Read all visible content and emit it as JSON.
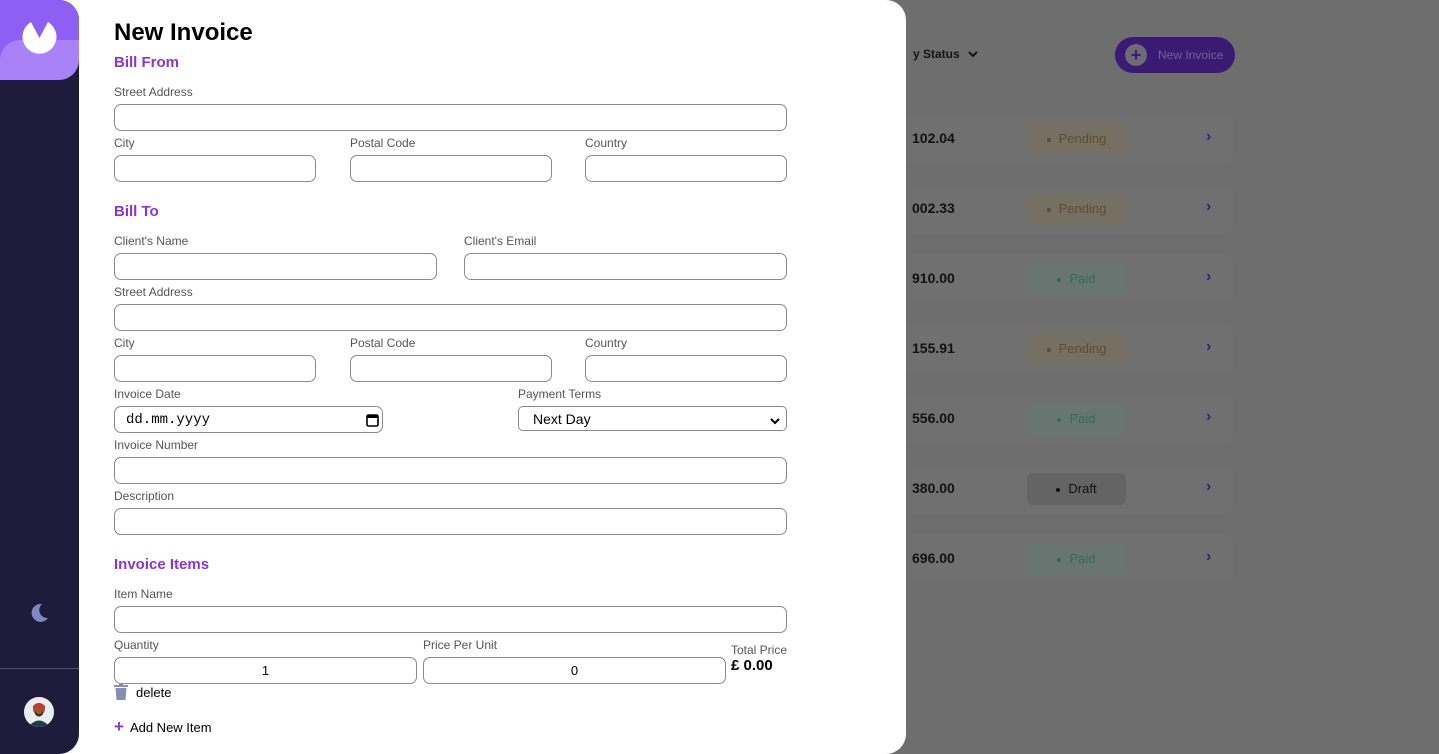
{
  "background": {
    "filter_label": "y Status",
    "new_invoice_label": "New Invoice",
    "rows": [
      {
        "amount": "102.04",
        "status": "Pending",
        "kind": "pending"
      },
      {
        "amount": "002.33",
        "status": "Pending",
        "kind": "pending"
      },
      {
        "amount": "910.00",
        "status": "Paid",
        "kind": "paid"
      },
      {
        "amount": "155.91",
        "status": "Pending",
        "kind": "pending"
      },
      {
        "amount": "556.00",
        "status": "Paid",
        "kind": "paid"
      },
      {
        "amount": "380.00",
        "status": "Draft",
        "kind": "draft"
      },
      {
        "amount": "696.00",
        "status": "Paid",
        "kind": "paid"
      }
    ]
  },
  "sidebar": {
    "logo_icon": "logo-icon",
    "theme_icon": "moon-icon",
    "avatar_icon": "avatar"
  },
  "form": {
    "title": "New Invoice",
    "bill_from": {
      "heading": "Bill From",
      "street_label": "Street Address",
      "street_value": "",
      "city_label": "City",
      "city_value": "",
      "postal_label": "Postal Code",
      "postal_value": "",
      "country_label": "Country",
      "country_value": ""
    },
    "bill_to": {
      "heading": "Bill To",
      "client_name_label": "Client's Name",
      "client_name_value": "",
      "client_email_label": "Client's Email",
      "client_email_value": "",
      "street_label": "Street Address",
      "street_value": "",
      "city_label": "City",
      "city_value": "",
      "postal_label": "Postal Code",
      "postal_value": "",
      "country_label": "Country",
      "country_value": ""
    },
    "invoice_date_label": "Invoice Date",
    "invoice_date_value": "dd.mm.yyyy",
    "payment_terms_label": "Payment Terms",
    "payment_terms_value": "Next Day",
    "invoice_number_label": "Invoice Number",
    "invoice_number_value": "",
    "description_label": "Description",
    "description_value": "",
    "items": {
      "heading": "Invoice Items",
      "item_name_label": "Item Name",
      "item_name_value": "",
      "quantity_label": "Quantity",
      "quantity_value": "1",
      "price_label": "Price Per Unit",
      "price_value": "0",
      "total_label": "Total Price",
      "total_value": "£ 0.00",
      "delete_label": "delete",
      "add_label": "Add New Item"
    }
  },
  "colors": {
    "accent": "#8a34d8",
    "sidebar": "#1f1b3a"
  }
}
